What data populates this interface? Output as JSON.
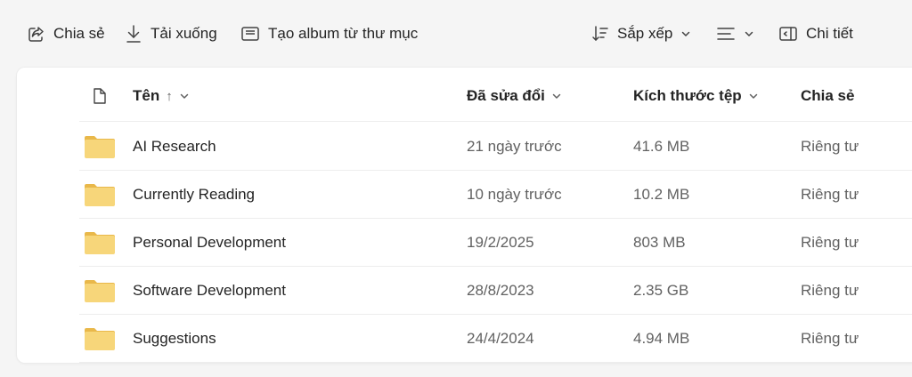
{
  "toolbar": {
    "share_label": "Chia sẻ",
    "download_label": "Tải xuống",
    "create_album_label": "Tạo album từ thư mục",
    "sort_label": "Sắp xếp",
    "details_label": "Chi tiết"
  },
  "table": {
    "headers": {
      "name": "Tên",
      "modified": "Đã sửa đổi",
      "size": "Kích thước tệp",
      "sharing": "Chia sẻ"
    },
    "rows": [
      {
        "name": "AI Research",
        "modified": "21 ngày trước",
        "size": "41.6 MB",
        "sharing": "Riêng tư"
      },
      {
        "name": "Currently Reading",
        "modified": "10 ngày trước",
        "size": "10.2 MB",
        "sharing": "Riêng tư"
      },
      {
        "name": "Personal Development",
        "modified": "19/2/2025",
        "size": "803 MB",
        "sharing": "Riêng tư"
      },
      {
        "name": "Software Development",
        "modified": "28/8/2023",
        "size": "2.35 GB",
        "sharing": "Riêng tư"
      },
      {
        "name": "Suggestions",
        "modified": "24/4/2024",
        "size": "4.94 MB",
        "sharing": "Riêng tư"
      }
    ]
  },
  "colors": {
    "folder": "#f7d67a",
    "folder_tab": "#e9b84a",
    "background": "#f5f5f5"
  }
}
